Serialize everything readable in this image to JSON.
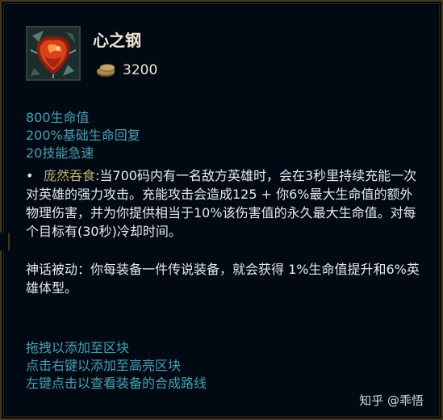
{
  "item": {
    "name": "心之钢",
    "icon": "heartsteel-icon",
    "cost": "3200",
    "cost_icon": "gold-coins-icon"
  },
  "stats": [
    "800生命值",
    "200%基础生命回复",
    "20技能急速"
  ],
  "passive": {
    "bullet": "•",
    "name": "庞然吞食",
    "text": ":当700码内有一名敌方英雄时，会在3秒里持续充能一次对英雄的强力攻击。充能攻击会造成125 + 你6%最大生命值的额外物理伤害，并为你提供相当于10%该伤害值的永久最大生命值。对每个目标有(30秒)冷却时间。"
  },
  "mythic": {
    "text": "神话被动：你每装备一件传说装备，就会获得 1%生命值提升和6%英雄体型。"
  },
  "hints": [
    "拖拽以添加至区块",
    "点击右键以添加至高亮区块",
    "左键点击以查看装备的合成路线"
  ],
  "watermark": "知乎 @乖悟",
  "colors": {
    "background": "#010a13",
    "border_gold": "#463714",
    "title": "#f0e6d2",
    "stat_blue": "#3fa3b5",
    "passive_gold": "#c8aa6e",
    "body_text": "#e8e8e8"
  }
}
